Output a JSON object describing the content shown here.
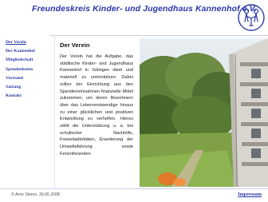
{
  "header": {
    "title": "Freundeskreis Kinder- und Jugendhaus Kannenhof e.V."
  },
  "nav": {
    "items": [
      {
        "label": "Der Verein"
      },
      {
        "label": "Der Kannenhof"
      },
      {
        "label": "Mitgliedschaft"
      },
      {
        "label": "Spendenkonto"
      },
      {
        "label": "Vorstand"
      },
      {
        "label": "Satzung"
      },
      {
        "label": "Kontakt"
      }
    ]
  },
  "main": {
    "heading": "Der Verein",
    "body": "Der Verein hat die Aufgabe, das städtische Kinder- und Jugendhaus Kannenhof in Solingen ideel und materiell zu unterstützen. Dabei sollen der Einrichtung aus den Spendeneinnahmen finanzielle Mittel zukommen, um deren Bewohnern über das Lebensnotwendige hinaus zu einer glücklichen und positiven Entwicklung zu verhelfen. Hierzu zählt die Unterstützung u. a. bei schulischer Nachhilfe, Freizeitaktivitäten, Erweiterung der Umweltefahrung sowie Ferienfreizeiten."
  },
  "footer": {
    "credit": "© Arne Simon, 30.06.2008",
    "impressum": "Impressum"
  },
  "colors": {
    "brand_blue": "#2a37a8"
  }
}
